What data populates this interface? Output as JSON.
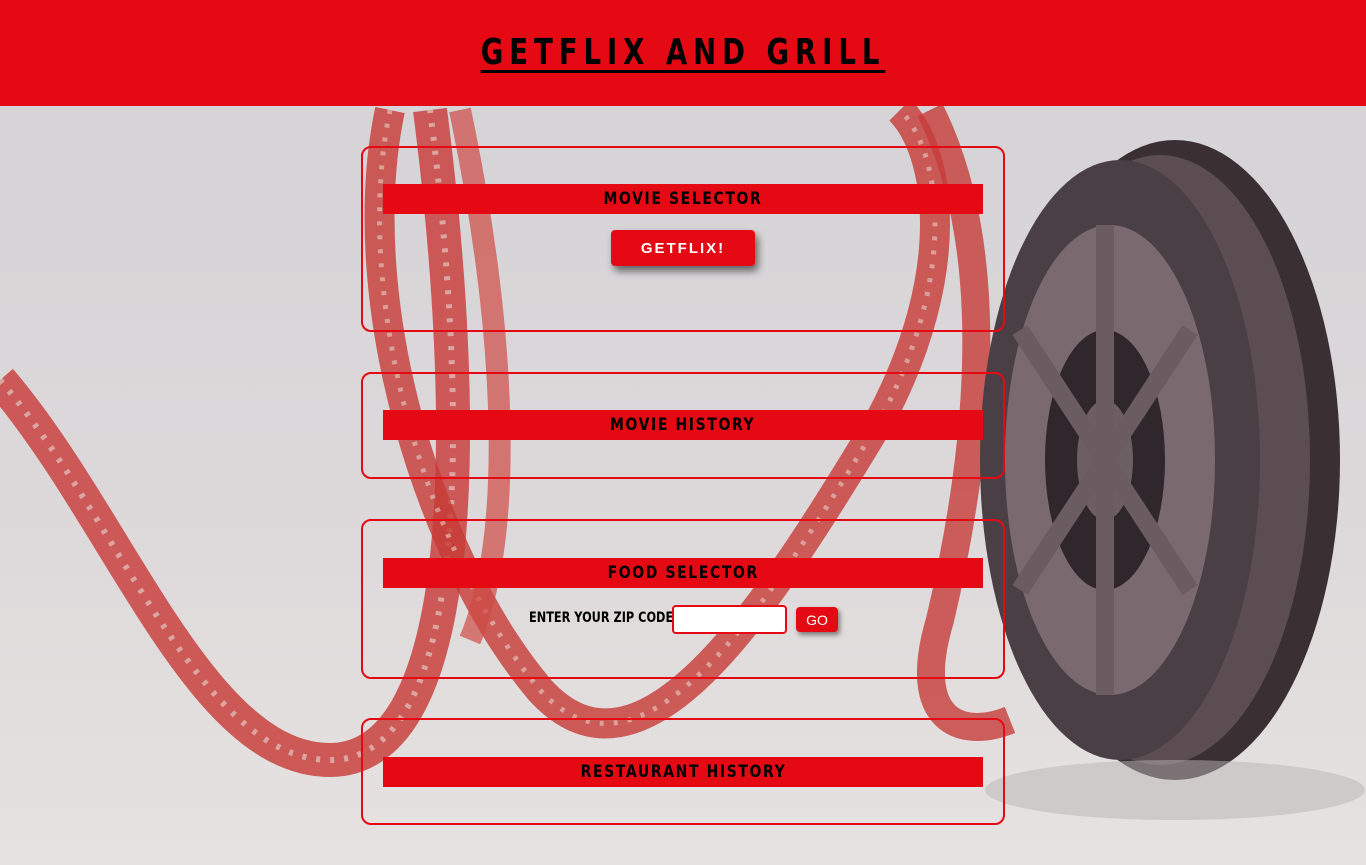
{
  "header": {
    "title": "GETFLIX AND GRILL"
  },
  "movie_selector": {
    "title": "MOVIE SELECTOR",
    "button_label": "GETFLIX!"
  },
  "movie_history": {
    "title": "MOVIE HISTORY"
  },
  "food_selector": {
    "title": "FOOD SELECTOR",
    "zip_label": "ENTER YOUR ZIP CODE:",
    "zip_value": "",
    "go_label": "GO"
  },
  "restaurant_history": {
    "title": "RESTAURANT HISTORY"
  },
  "colors": {
    "accent": "#e50914",
    "text": "#000000"
  }
}
